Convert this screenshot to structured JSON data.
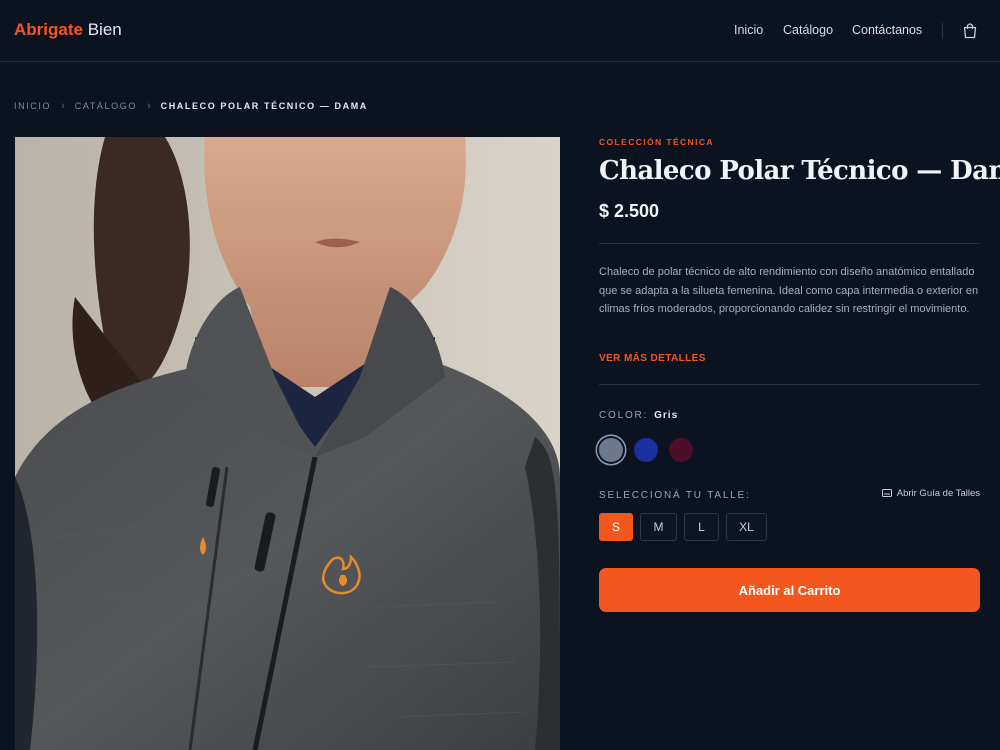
{
  "nav": {
    "brand_accent": "Abrigate",
    "brand_rest": "Bien",
    "links": [
      "Inicio",
      "Catálogo",
      "Contáctanos"
    ],
    "cart_icon": "shopping-bag-icon"
  },
  "breadcrumb": {
    "items": [
      "Inicio",
      "Catálogo"
    ],
    "current": "Chaleco Polar Técnico — Dama",
    "separator": "›"
  },
  "product": {
    "image_icon": "product-photo-vest",
    "collection": "Colección Técnica",
    "title": "Chaleco Polar Técnico — Dama",
    "price": "$ 2.500",
    "description": "Chaleco de polar técnico de alto rendimiento con diseño anatómico entallado que se adapta a la silueta femenina. Ideal como capa intermedia o exterior en climas fríos moderados, proporcionando calidez sin restringir el movimiento.",
    "more_details": "VER MÁS DETALLES",
    "color": {
      "label": "Color:",
      "selected": "Gris",
      "swatches": [
        "#6b7a8f",
        "#1a2fa0",
        "#4b0f2a"
      ]
    },
    "size": {
      "label": "Seleccioná tu talle:",
      "guide": "Abrir Guía de Talles",
      "options": [
        "S",
        "M",
        "L",
        "XL"
      ],
      "selected": "S"
    },
    "add_to_cart": "Añadir al Carrito"
  },
  "colors": {
    "accent": "#f4571e",
    "background": "#0b1220"
  }
}
